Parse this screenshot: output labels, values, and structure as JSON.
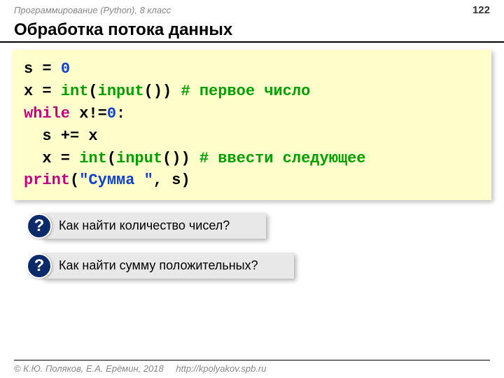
{
  "header": {
    "course_label": "Программирование (Python), 8 класс",
    "page_number": "122"
  },
  "title": "Обработка потока данных",
  "code": {
    "line1": {
      "var": "s = ",
      "val": "0"
    },
    "line2": {
      "pre": "x = ",
      "func": "int",
      "paren_open": "(",
      "input": "input",
      "paren_close": "())",
      "comment": " # первое число"
    },
    "line3": {
      "kw": "while",
      "rest": " x!=",
      "zero": "0",
      "colon": ":"
    },
    "line4": {
      "text": "  s += x"
    },
    "line5": {
      "pre": "  x = ",
      "func": "int",
      "paren_open": "(",
      "input": "input",
      "paren_close": "())",
      "comment": " # ввести следующее"
    },
    "line6": {
      "print": "print",
      "paren": "(",
      "str": "\"Сумма \"",
      "rest": ", s)"
    }
  },
  "questions": {
    "q1": {
      "badge": "?",
      "text": "Как найти количество чисел?"
    },
    "q2": {
      "badge": "?",
      "text": "Как найти сумму положительных?"
    }
  },
  "footer": {
    "copyright": "© К.Ю. Поляков, Е.А. Ерёмин, 2018",
    "url": "http://kpolyakov.spb.ru"
  }
}
